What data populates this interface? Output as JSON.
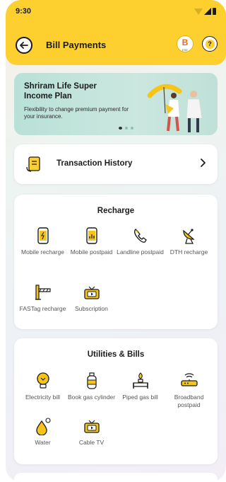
{
  "status_bar": {
    "time": "9:30"
  },
  "header": {
    "title": "Bill Payments",
    "badge_letter": "B",
    "badge_text": "ESE"
  },
  "banner": {
    "title": "Shriram Life Super Income Plan",
    "subtitle": "Flexibility to change premium payment for your insurance."
  },
  "transaction_history": {
    "label": "Transaction History"
  },
  "recharge": {
    "title": "Recharge",
    "items": [
      {
        "label": "Mobile recharge",
        "icon": "mobile-recharge-icon"
      },
      {
        "label": "Mobile postpaid",
        "icon": "mobile-postpaid-icon"
      },
      {
        "label": "Landline postpaid",
        "icon": "landline-icon"
      },
      {
        "label": "DTH recharge",
        "icon": "dth-dish-icon"
      },
      {
        "label": "FASTag recharge",
        "icon": "fastag-icon"
      },
      {
        "label": "Subscription",
        "icon": "subscription-tv-icon"
      }
    ]
  },
  "utilities": {
    "title": "Utilities & Bills",
    "items": [
      {
        "label": "Electricity bill",
        "icon": "electricity-bulb-icon"
      },
      {
        "label": "Book gas cylinder",
        "icon": "gas-cylinder-icon"
      },
      {
        "label": "Piped gas bill",
        "icon": "piped-gas-icon"
      },
      {
        "label": "Broadband postpaid",
        "icon": "broadband-router-icon"
      },
      {
        "label": "Water",
        "icon": "water-drop-icon"
      },
      {
        "label": "Cable TV",
        "icon": "cable-tv-icon"
      }
    ]
  },
  "colors": {
    "accent_yellow": "#fdd02f",
    "icon_yellow": "#f7c518",
    "text_dark": "#1c1c1c"
  }
}
